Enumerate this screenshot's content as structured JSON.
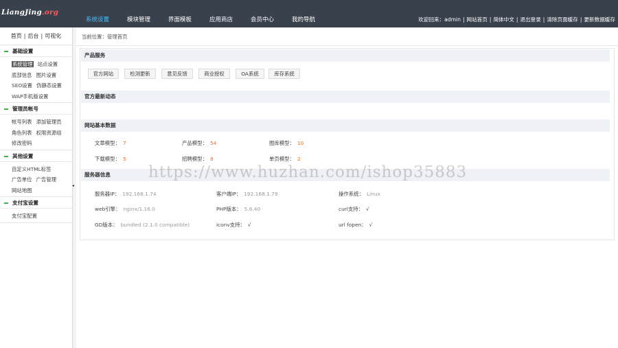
{
  "brand": {
    "name": "LiangJing",
    "suffix": ".org"
  },
  "nav": [
    "系统设置",
    "模块管理",
    "界面模板",
    "应用商店",
    "会员中心",
    "我的导航"
  ],
  "nav_active": 0,
  "top": {
    "welcome": "欢迎回来：admin",
    "links": [
      "网站首页",
      "简体中文",
      "退出登录",
      "清除页面缓存",
      "更新数据缓存"
    ]
  },
  "side": {
    "top_links": [
      "首页",
      "后台",
      "可视化"
    ],
    "groups": [
      {
        "title": "基础设置",
        "rows": [
          [
            "系统管理",
            "站点设置"
          ],
          [
            "底部信息",
            "图片设置"
          ],
          [
            "SEO设置",
            "伪静态设置"
          ],
          [
            "WAP手机版设置"
          ]
        ]
      },
      {
        "title": "管理员帐号",
        "rows": [
          [
            "帐号列表",
            "添加管理员"
          ],
          [
            "角色列表",
            "权限资源组"
          ],
          [
            "修改密码"
          ]
        ]
      },
      {
        "title": "其他设置",
        "rows": [
          [
            "自定义HTML标签"
          ],
          [
            "广告单位",
            "广告管理"
          ],
          [
            "网站地图"
          ]
        ]
      },
      {
        "title": "支付宝设置",
        "rows": [
          [
            "支付宝配置"
          ]
        ]
      }
    ]
  },
  "breadcrumb": "当前位置：管理首页",
  "sections": {
    "products": "产品服务",
    "news": "官方最新动态",
    "stats": "网站基本数据",
    "server": "服务器信息"
  },
  "product_buttons": [
    "官方网站",
    "检测更新",
    "意见反馈",
    "商业授权",
    "OA系统",
    "库存系统"
  ],
  "stats": [
    {
      "label": "文章模型：",
      "value": "7"
    },
    {
      "label": "产品模型：",
      "value": "54"
    },
    {
      "label": "图库模型：",
      "value": "10"
    },
    {
      "label": "下载模型：",
      "value": "5"
    },
    {
      "label": "招聘模型：",
      "value": "8"
    },
    {
      "label": "单页模型：",
      "value": "2"
    }
  ],
  "server": [
    {
      "label": "服务器IP：",
      "value": "192.168.1.74"
    },
    {
      "label": "客户端IP：",
      "value": "192.168.1.79"
    },
    {
      "label": "操作系统：",
      "value": "Linux"
    },
    {
      "label": "web引擎：",
      "value": "nginx/1.16.0"
    },
    {
      "label": "PHP版本：",
      "value": "5.6.40"
    },
    {
      "label": "curl支持：",
      "value": "√"
    },
    {
      "label": "GD版本：",
      "value": "bundled (2.1.0 compatible)"
    },
    {
      "label": "iconv支持：",
      "value": "√"
    },
    {
      "label": "url fopen：",
      "value": "√"
    }
  ],
  "watermark": "https://www.huzhan.com/ishop35883",
  "collapse_arrow": "◂"
}
